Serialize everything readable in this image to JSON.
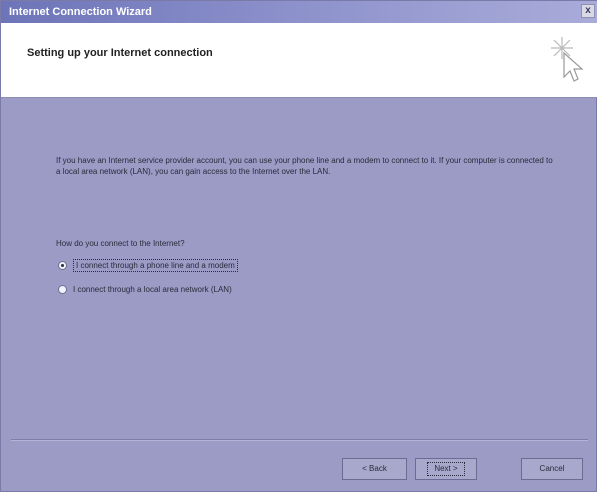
{
  "window": {
    "title": "Internet Connection Wizard",
    "close_symbol": "x"
  },
  "header": {
    "title": "Setting up your Internet connection",
    "icon": "wizard-sparkle-cursor-icon"
  },
  "body": {
    "intro": "If you have an Internet service provider account, you can use your phone line and a modem to connect to it. If your computer is connected to a local area network (LAN), you can gain access to the Internet over the LAN.",
    "question": "How do you connect to the Internet?",
    "options": [
      {
        "label": "I connect through a phone line and a modem",
        "selected": true
      },
      {
        "label": "I connect through a local area network (LAN)",
        "selected": false
      }
    ]
  },
  "footer": {
    "back_label": "< Back",
    "next_label": "Next >",
    "cancel_label": "Cancel"
  }
}
